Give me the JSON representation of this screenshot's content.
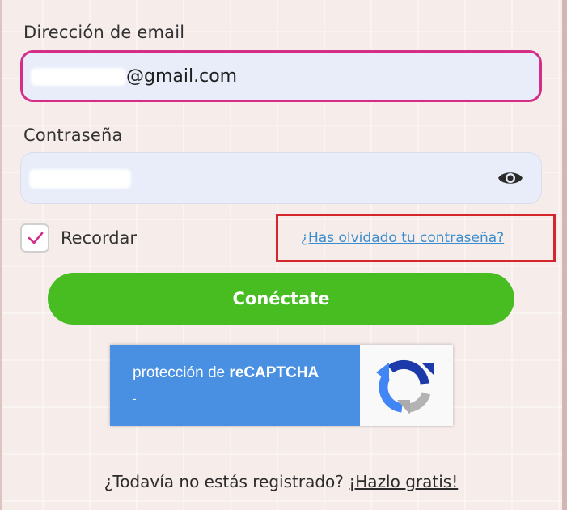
{
  "form": {
    "email_label": "Dirección de email",
    "email_value": "@gmail.com",
    "password_label": "Contraseña",
    "remember_label": "Recordar",
    "forgot_password_link": "¿Has olvidado tu contraseña?",
    "connect_button": "Conéctate"
  },
  "recaptcha": {
    "text_prefix": "protección de ",
    "text_brand": "reCAPTCHA",
    "sub_text": "-"
  },
  "signup": {
    "prompt": "¿Todavía no estás registrado?",
    "link": "¡Hazlo gratis!"
  },
  "icons": {
    "show_password": "eye-icon",
    "remember_check": "checkmark-icon",
    "recaptcha_logo": "recaptcha-logo-icon"
  },
  "colors": {
    "accent_pink": "#d42e88",
    "connect_green": "#47bd22",
    "link_blue": "#3a8ecf",
    "highlight_red": "#d4262c",
    "recaptcha_blue": "#4a90e2"
  }
}
